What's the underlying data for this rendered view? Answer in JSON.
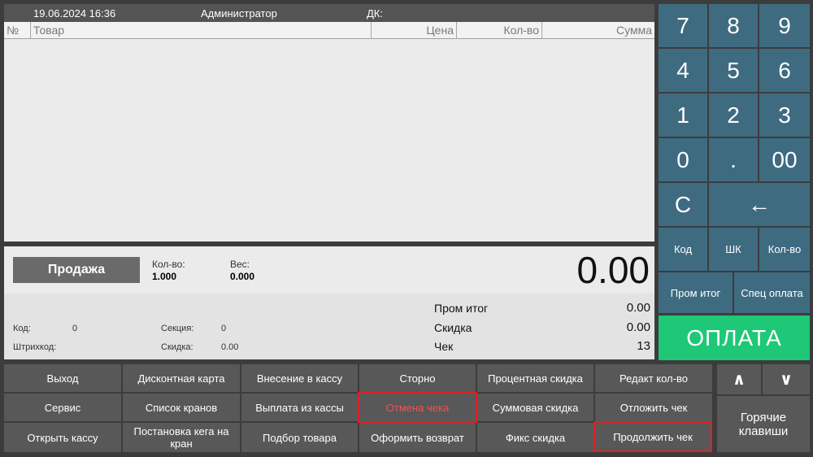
{
  "header": {
    "datetime": "19.06.2024 16:36",
    "user": "Администратор",
    "card_label": "ДК:"
  },
  "table": {
    "columns": [
      "№",
      "Товар",
      "Цена",
      "Кол-во",
      "Сумма"
    ]
  },
  "sale": {
    "mode_button": "Продажа",
    "qty_label": "Кол-во:",
    "qty_value": "1.000",
    "weight_label": "Вес:",
    "weight_value": "0.000",
    "total": "0.00"
  },
  "details": {
    "code_label": "Код:",
    "code_value": "0",
    "section_label": "Секция:",
    "section_value": "0",
    "barcode_label": "Штрихкод:",
    "discount_label": "Скидка:",
    "discount_value": "0.00",
    "subtotal_label": "Пром итог",
    "subtotal_value": "0.00",
    "discount_sum_label": "Скидка",
    "discount_sum_value": "0.00",
    "check_label": "Чек",
    "check_value": "13"
  },
  "numpad": {
    "k7": "7",
    "k8": "8",
    "k9": "9",
    "k4": "4",
    "k5": "5",
    "k6": "6",
    "k1": "1",
    "k2": "2",
    "k3": "3",
    "k0": "0",
    "kdot": ".",
    "k00": "00",
    "clear": "C",
    "backspace": "←",
    "code": "Код",
    "barcode": "ШК",
    "qty": "Кол-во",
    "subtotal": "Пром итог",
    "special_pay": "Спец оплата",
    "pay": "ОПЛАТА"
  },
  "functions": {
    "exit": "Выход",
    "discount_card": "Дисконтная карта",
    "cash_in": "Внесение в кассу",
    "storno": "Сторно",
    "percent_discount": "Процентная скидка",
    "edit_qty": "Редакт кол-во",
    "service": "Сервис",
    "tap_list": "Список кранов",
    "cash_out": "Выплата из кассы",
    "cancel_check": "Отмена чека",
    "sum_discount": "Суммовая скидка",
    "defer_check": "Отложить чек",
    "open_register": "Открыть кассу",
    "keg_install": "Постановка кега на кран",
    "product_pick": "Подбор товара",
    "refund": "Оформить возврат",
    "fixed_discount": "Фикс скидка",
    "continue_check": "Продолжить чек"
  },
  "side": {
    "up": "∧",
    "down": "∨",
    "hotkeys": "Горячие клавиши"
  },
  "colors": {
    "numpad": "#3f6b80",
    "pay": "#1ec877",
    "button": "#585858",
    "highlight": "#e01f26"
  }
}
